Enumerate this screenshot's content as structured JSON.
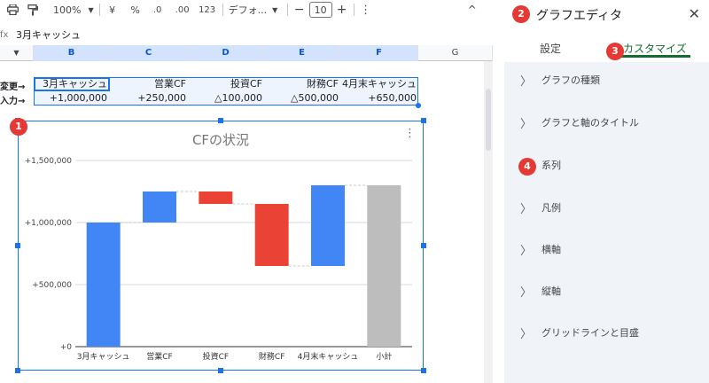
{
  "toolbar": {
    "zoom": "100%",
    "currency": "¥",
    "percent": "%",
    "dec_less": ".0",
    "dec_more": ".00",
    "number_fmt": "123",
    "font": "デフォ...",
    "font_size": "10",
    "minus": "−",
    "plus": "+",
    "more": "⋮",
    "collapse": "^"
  },
  "formula_bar": {
    "cell_ref": "fx",
    "content": "3月キャッシュ"
  },
  "columns": [
    "B",
    "C",
    "D",
    "E",
    "F",
    "G"
  ],
  "rows": [
    {
      "label": "変更→",
      "cells": [
        "3月キャッシュ",
        "営業CF",
        "投資CF",
        "財務CF",
        "4月末キャッシュ"
      ]
    },
    {
      "label": "入力→",
      "cells": [
        "+1,000,000",
        "+250,000",
        "△100,000",
        "△500,000",
        "+650,000"
      ]
    }
  ],
  "chart_data": {
    "type": "bar",
    "title": "CFの状況",
    "categories": [
      "3月キャッシュ",
      "営業CF",
      "投資CF",
      "財務CF",
      "4月末キャッシュ",
      "小計"
    ],
    "ylim": [
      0,
      1500000
    ],
    "yticks": [
      "+0",
      "+500,000",
      "+1,000,000",
      "+1,500,000"
    ],
    "ytick_values": [
      0,
      500000,
      1000000,
      1500000
    ],
    "series": [
      {
        "values": [
          [
            0,
            1000000
          ],
          [
            1000000,
            1250000
          ],
          [
            1150000,
            1250000
          ],
          [
            650000,
            1150000
          ],
          [
            650000,
            1300000
          ],
          [
            0,
            1300000
          ]
        ]
      }
    ],
    "colors": [
      "#4285f4",
      "#4285f4",
      "#ea4335",
      "#ea4335",
      "#4285f4",
      "#bdbdbd"
    ],
    "grid": true
  },
  "panel": {
    "title": "グラフエディタ",
    "close": "✕",
    "tabs": [
      "設定",
      "カスタマイズ"
    ],
    "sections": [
      "グラフの種類",
      "グラフと軸のタイトル",
      "系列",
      "凡例",
      "横軸",
      "縦軸",
      "グリッドラインと目盛"
    ]
  },
  "badges": [
    "1",
    "2",
    "3",
    "4"
  ],
  "accent": "#1a73e8",
  "badge_color": "#e53935"
}
